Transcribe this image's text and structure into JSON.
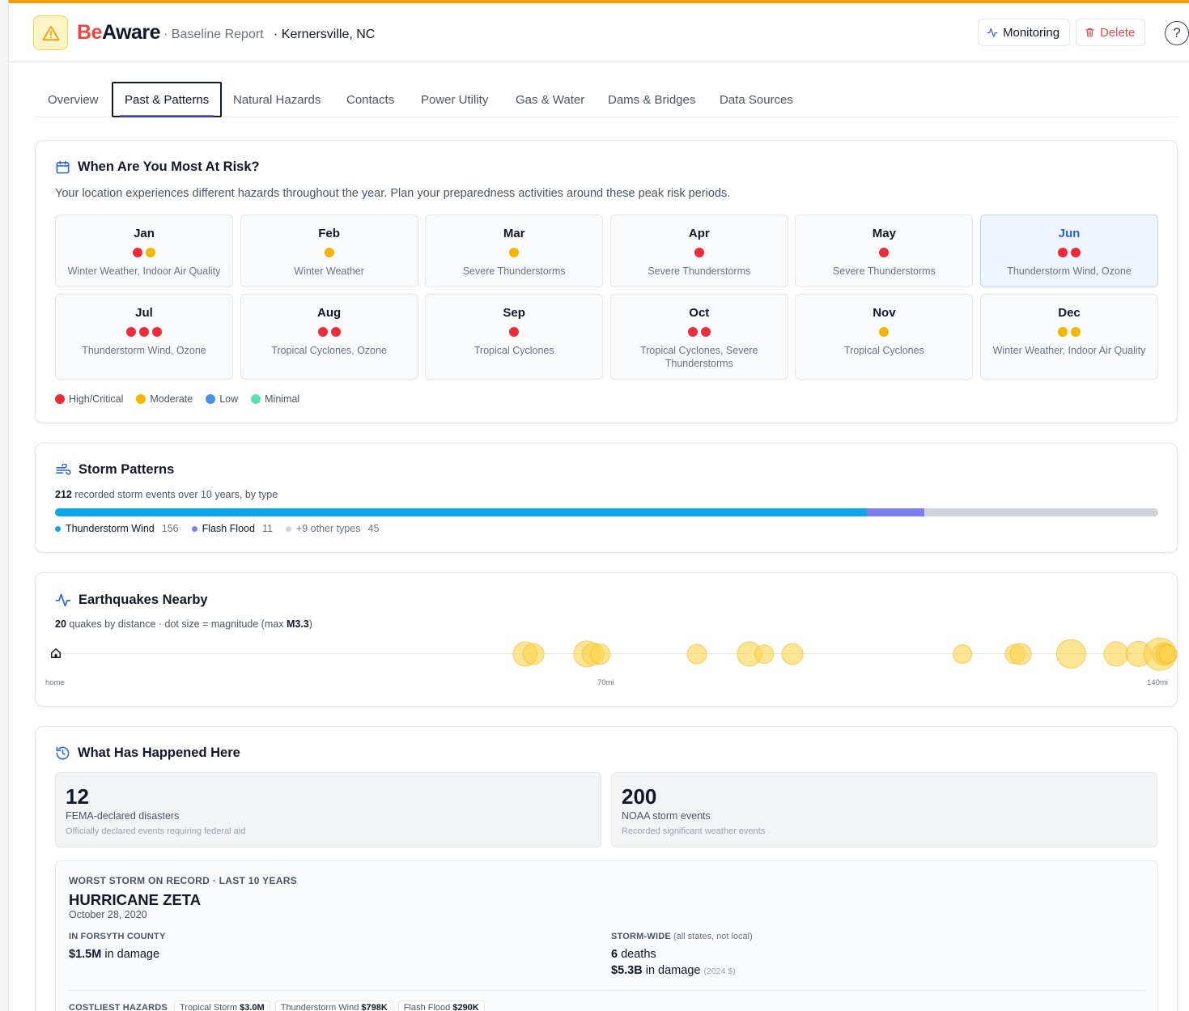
{
  "header": {
    "brand_be": "Be",
    "brand_aware": "Aware",
    "report_type": "· Baseline Report",
    "location": "· Kernersville, NC",
    "monitoring_label": "Monitoring",
    "delete_label": "Delete",
    "help_label": "?"
  },
  "tabs": [
    {
      "label": "Overview"
    },
    {
      "label": "Past & Patterns"
    },
    {
      "label": "Natural Hazards"
    },
    {
      "label": "Contacts"
    },
    {
      "label": "Power Utility"
    },
    {
      "label": "Gas & Water"
    },
    {
      "label": "Dams & Bridges"
    },
    {
      "label": "Data Sources"
    }
  ],
  "colors": {
    "high": "#ef2b3a",
    "moderate": "#f7b500",
    "low": "#4a90f0",
    "minimal": "#5ee0b0",
    "thunderstorm": "#0ea5e9",
    "flashflood": "#7c7ef0",
    "other": "#d1d5db"
  },
  "risk": {
    "title": "When Are You Most At Risk?",
    "description": "Your location experiences different hazards throughout the year. Plan your preparedness activities around these peak risk periods.",
    "months": [
      {
        "name": "Jan",
        "dots": [
          "high",
          "moderate"
        ],
        "text": "Winter Weather, Indoor Air Quality"
      },
      {
        "name": "Feb",
        "dots": [
          "moderate"
        ],
        "text": "Winter Weather"
      },
      {
        "name": "Mar",
        "dots": [
          "moderate"
        ],
        "text": "Severe Thunderstorms"
      },
      {
        "name": "Apr",
        "dots": [
          "high"
        ],
        "text": "Severe Thunderstorms"
      },
      {
        "name": "May",
        "dots": [
          "high"
        ],
        "text": "Severe Thunderstorms"
      },
      {
        "name": "Jun",
        "dots": [
          "high",
          "high"
        ],
        "text": "Thunderstorm Wind, Ozone",
        "current": true
      },
      {
        "name": "Jul",
        "dots": [
          "high",
          "high",
          "high"
        ],
        "text": "Thunderstorm Wind, Ozone"
      },
      {
        "name": "Aug",
        "dots": [
          "high",
          "high"
        ],
        "text": "Tropical Cyclones, Ozone"
      },
      {
        "name": "Sep",
        "dots": [
          "high"
        ],
        "text": "Tropical Cyclones"
      },
      {
        "name": "Oct",
        "dots": [
          "high",
          "high"
        ],
        "text": "Tropical Cyclones, Severe Thunderstorms"
      },
      {
        "name": "Nov",
        "dots": [
          "moderate"
        ],
        "text": "Tropical Cyclones"
      },
      {
        "name": "Dec",
        "dots": [
          "moderate",
          "moderate"
        ],
        "text": "Winter Weather, Indoor Air Quality"
      }
    ],
    "legend": [
      {
        "key": "high",
        "label": "High/Critical"
      },
      {
        "key": "moderate",
        "label": "Moderate"
      },
      {
        "key": "low",
        "label": "Low"
      },
      {
        "key": "minimal",
        "label": "Minimal"
      }
    ]
  },
  "storm": {
    "title": "Storm Patterns",
    "total": "212",
    "subtitle_rest": "recorded storm events over 10 years, by type",
    "types": [
      {
        "key": "thunderstorm",
        "label": "Thunderstorm Wind",
        "count": 156
      },
      {
        "key": "flashflood",
        "label": "Flash Flood",
        "count": 11
      },
      {
        "key": "other",
        "label": "+9 other types",
        "count": 45
      }
    ]
  },
  "quakes": {
    "title": "Earthquakes Nearby",
    "count": "20",
    "subtitle_mid": "quakes by distance · dot size = magnitude (max",
    "max_mag": "M3.3",
    "subtitle_end": ")",
    "axis_labels": {
      "home": "home",
      "mid": "70mi",
      "max": "140mi"
    },
    "max_distance_mi": 140,
    "events": [
      {
        "dist": 77.0,
        "mag": 2.4
      },
      {
        "dist": 78.3,
        "mag": 2.0
      },
      {
        "dist": 87.1,
        "mag": 2.6
      },
      {
        "dist": 88.2,
        "mag": 2.1
      },
      {
        "dist": 89.3,
        "mag": 1.9
      },
      {
        "dist": 105.2,
        "mag": 1.8
      },
      {
        "dist": 113.7,
        "mag": 2.4
      },
      {
        "dist": 116.2,
        "mag": 1.7
      },
      {
        "dist": 120.8,
        "mag": 2.0
      },
      {
        "dist": 148.6,
        "mag": 1.7
      },
      {
        "dist": 157.3,
        "mag": 1.8
      },
      {
        "dist": 158.2,
        "mag": 2.0
      },
      {
        "dist": 166.4,
        "mag": 2.9
      },
      {
        "dist": 173.8,
        "mag": 2.4
      },
      {
        "dist": 177.5,
        "mag": 2.5
      },
      {
        "dist": 181.0,
        "mag": 3.3
      },
      {
        "dist": 181.6,
        "mag": 2.2
      },
      {
        "dist": 181.9,
        "mag": 1.9
      },
      {
        "dist": 182.1,
        "mag": 1.7
      },
      {
        "dist": 182.3,
        "mag": 1.6
      }
    ]
  },
  "history": {
    "title": "What Has Happened Here",
    "fema": {
      "num": "12",
      "label": "FEMA-declared disasters",
      "note": "Officially declared events requiring federal aid"
    },
    "noaa": {
      "num": "200",
      "label": "NOAA storm events",
      "note": "Recorded significant weather events"
    },
    "worst": {
      "kicker": "WORST STORM ON RECORD · LAST 10 YEARS",
      "name": "HURRICANE ZETA",
      "date": "October 28, 2020",
      "local_heading": "IN FORSYTH COUNTY",
      "local_damage": "$1.5M",
      "local_damage_suffix": " in damage",
      "wide_heading": "STORM-WIDE",
      "wide_heading_note": " (all states, not local)",
      "deaths": "6",
      "deaths_suffix": " deaths",
      "wide_damage": "$5.3B",
      "wide_damage_suffix": " in damage",
      "wide_damage_note": "(2024 $)",
      "costly_heading": "COSTLIEST HAZARDS",
      "costly": [
        {
          "label": "Tropical Storm",
          "value": "$3.0M"
        },
        {
          "label": "Thunderstorm Wind",
          "value": "$798K"
        },
        {
          "label": "Flash Flood",
          "value": "$290K"
        }
      ]
    }
  }
}
